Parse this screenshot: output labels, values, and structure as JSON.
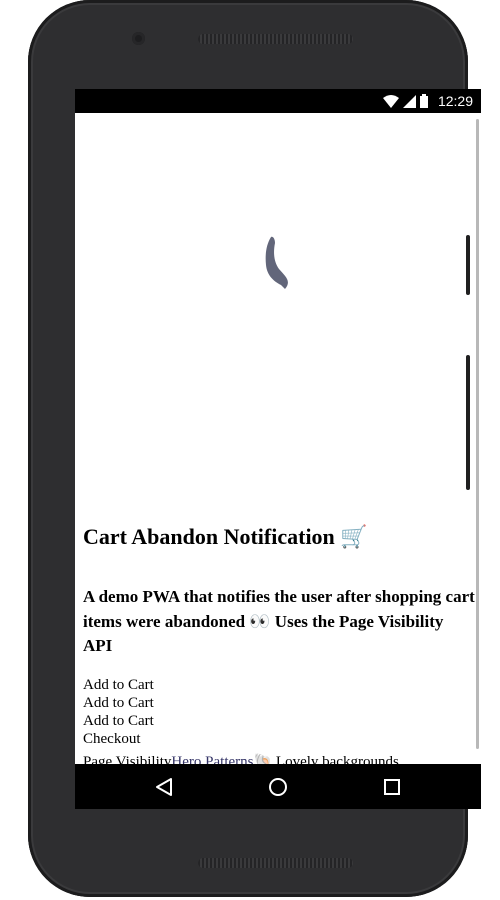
{
  "device": {
    "frame_color": "#2e2e30",
    "icons": {
      "camera": "front-camera-icon",
      "speaker": "speaker-grille-icon"
    }
  },
  "status_bar": {
    "time": "12:29",
    "icons": [
      "wifi-icon",
      "cellular-signal-icon",
      "battery-icon"
    ]
  },
  "page": {
    "loader_icon": "loading-spinner-icon",
    "loader_color": "#62667a",
    "title": "Cart Abandon Notification 🛒",
    "description": "A demo PWA that notifies the user after shopping cart items were abandoned 👀 Uses the Page Visibility API",
    "actions": [
      "Add to Cart",
      "Add to Cart",
      "Add to Cart",
      "Checkout"
    ],
    "footer": {
      "label": "Page Visibility",
      "link_text": "Hero Patterns",
      "link_color": "#333366",
      "trailing_text": "🐚 Lovely backgrounds"
    }
  },
  "nav_bar": {
    "buttons": [
      "back-icon",
      "home-icon",
      "recents-icon"
    ]
  }
}
